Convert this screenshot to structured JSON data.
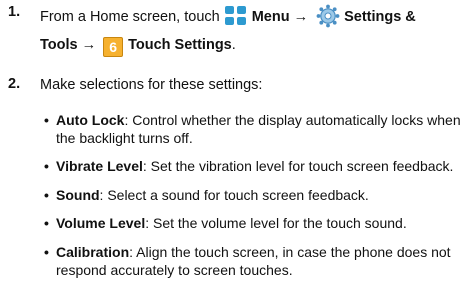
{
  "step1": {
    "number": "1.",
    "prefix": "From a Home screen, touch",
    "menu_label": "Menu",
    "arrow1": "→",
    "settings_label": "Settings &",
    "tools_label": "Tools",
    "arrow2": "→",
    "box_number": "6",
    "touch_settings_label": "Touch Settings",
    "period": "."
  },
  "step2": {
    "number": "2.",
    "text": "Make selections for these settings:"
  },
  "bullets": [
    {
      "term": "Auto Lock",
      "line1": ": Control whether the display automatically locks when",
      "line2": "the backlight turns off."
    },
    {
      "term": "Vibrate Level",
      "line1": ": Set the vibration level for touch screen feedback.",
      "line2": ""
    },
    {
      "term": "Sound",
      "line1": ": Select a sound for touch screen feedback.",
      "line2": ""
    },
    {
      "term": "Volume Level",
      "line1": ": Set the volume level for the touch sound.",
      "line2": ""
    },
    {
      "term": "Calibration",
      "line1": ": Align the touch screen, in case the phone does not",
      "line2": "respond accurately to screen touches."
    }
  ],
  "colors": {
    "menu_icon": "#2d9ad0",
    "box_fill": "#f6b12f",
    "gear": "#4a8fc4"
  }
}
